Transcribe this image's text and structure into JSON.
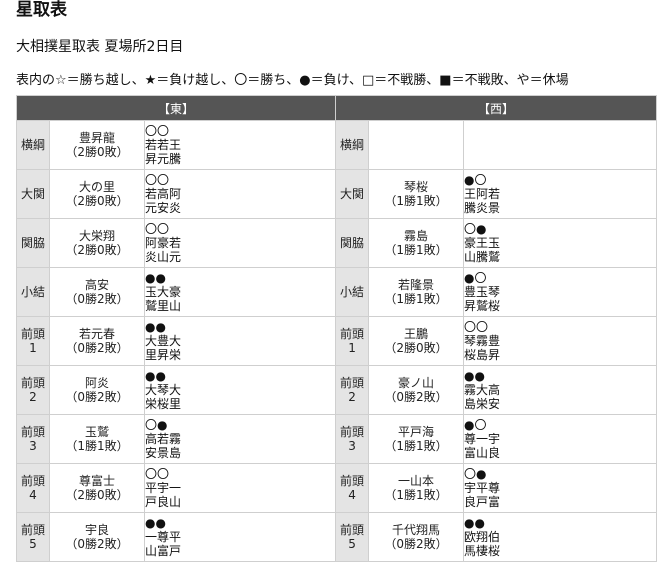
{
  "heading": "星取表",
  "subtitle": "大相撲星取表 夏場所2日目",
  "legend": "表内の☆＝勝ち越し、★＝負け越し、〇＝勝ち、●＝負け、□＝不戦勝、■＝不戦敗、や＝休場",
  "table": {
    "east_header": "【東】",
    "west_header": "【西】",
    "rows": [
      {
        "rank_east": "横綱",
        "east": {
          "name": "豊昇龍",
          "record": "（2勝0敗）",
          "marks": "〇〇",
          "opp1": "若若王",
          "opp2": "昇元騰"
        },
        "rank_west": "横綱",
        "west": {
          "name": "",
          "record": "",
          "marks": "",
          "opp1": "",
          "opp2": ""
        }
      },
      {
        "rank_east": "大関",
        "east": {
          "name": "大の里",
          "record": "（2勝0敗）",
          "marks": "〇〇",
          "opp1": "若高阿",
          "opp2": "元安炎"
        },
        "rank_west": "大関",
        "west": {
          "name": "琴桜",
          "record": "（1勝1敗）",
          "marks": "●〇",
          "opp1": "王阿若",
          "opp2": "騰炎景"
        }
      },
      {
        "rank_east": "関脇",
        "east": {
          "name": "大栄翔",
          "record": "（2勝0敗）",
          "marks": "〇〇",
          "opp1": "阿豪若",
          "opp2": "炎山元"
        },
        "rank_west": "関脇",
        "west": {
          "name": "霧島",
          "record": "（1勝1敗）",
          "marks": "〇●",
          "opp1": "豪王玉",
          "opp2": "山騰鷲"
        }
      },
      {
        "rank_east": "小結",
        "east": {
          "name": "高安",
          "record": "（0勝2敗）",
          "marks": "●●",
          "opp1": "玉大豪",
          "opp2": "鷲里山"
        },
        "rank_west": "小結",
        "west": {
          "name": "若隆景",
          "record": "（1勝1敗）",
          "marks": "●〇",
          "opp1": "豊玉琴",
          "opp2": "昇鷲桜"
        }
      },
      {
        "rank_east": "前頭\n1",
        "east": {
          "name": "若元春",
          "record": "（0勝2敗）",
          "marks": "●●",
          "opp1": "大豊大",
          "opp2": "里昇栄"
        },
        "rank_west": "前頭\n1",
        "west": {
          "name": "王鵬",
          "record": "（2勝0敗）",
          "marks": "〇〇",
          "opp1": "琴霧豊",
          "opp2": "桜島昇"
        }
      },
      {
        "rank_east": "前頭\n2",
        "east": {
          "name": "阿炎",
          "record": "（0勝2敗）",
          "marks": "●●",
          "opp1": "大琴大",
          "opp2": "栄桜里"
        },
        "rank_west": "前頭\n2",
        "west": {
          "name": "豪ノ山",
          "record": "（0勝2敗）",
          "marks": "●●",
          "opp1": "霧大高",
          "opp2": "島栄安"
        }
      },
      {
        "rank_east": "前頭\n3",
        "east": {
          "name": "玉鷲",
          "record": "（1勝1敗）",
          "marks": "〇●",
          "opp1": "高若霧",
          "opp2": "安景島"
        },
        "rank_west": "前頭\n3",
        "west": {
          "name": "平戸海",
          "record": "（1勝1敗）",
          "marks": "●〇",
          "opp1": "尊一宇",
          "opp2": "富山良"
        }
      },
      {
        "rank_east": "前頭\n4",
        "east": {
          "name": "尊富士",
          "record": "（2勝0敗）",
          "marks": "〇〇",
          "opp1": "平宇一",
          "opp2": "戸良山"
        },
        "rank_west": "前頭\n4",
        "west": {
          "name": "一山本",
          "record": "（1勝1敗）",
          "marks": "〇●",
          "opp1": "宇平尊",
          "opp2": "良戸富"
        }
      },
      {
        "rank_east": "前頭\n5",
        "east": {
          "name": "宇良",
          "record": "（0勝2敗）",
          "marks": "●●",
          "opp1": "一尊平",
          "opp2": "山富戸"
        },
        "rank_west": "前頭\n5",
        "west": {
          "name": "千代翔馬",
          "record": "（0勝2敗）",
          "marks": "●●",
          "opp1": "欧翔伯",
          "opp2": "馬棲桜"
        }
      }
    ]
  }
}
